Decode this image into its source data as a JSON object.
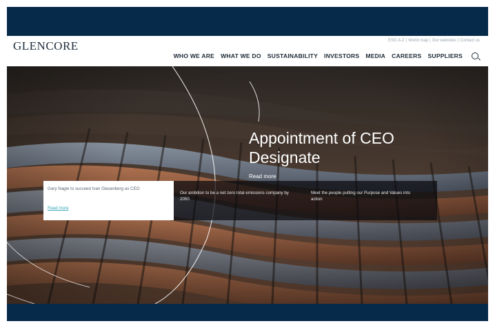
{
  "header": {
    "logo": "GLENCORE",
    "utility_links": [
      "ESG A-Z",
      "World map",
      "Our websites",
      "Contact us"
    ],
    "nav": [
      "WHO WE ARE",
      "WHAT WE DO",
      "SUSTAINABILITY",
      "INVESTORS",
      "MEDIA",
      "CAREERS",
      "SUPPLIERS"
    ],
    "search_icon": "search-icon"
  },
  "hero": {
    "title": "Appointment of CEO Designate",
    "link": "Read more"
  },
  "cards": [
    {
      "text": "Gary Nagle to succeed Ivan Glasenberg as CEO",
      "link": "Read more"
    },
    {
      "text": "Our ambition to be a net zero total emissions company by 2050"
    },
    {
      "text": "Meet the people putting our Purpose and Values into action"
    }
  ],
  "colors": {
    "band": "#062a49",
    "accent": "#3aa7b8"
  }
}
